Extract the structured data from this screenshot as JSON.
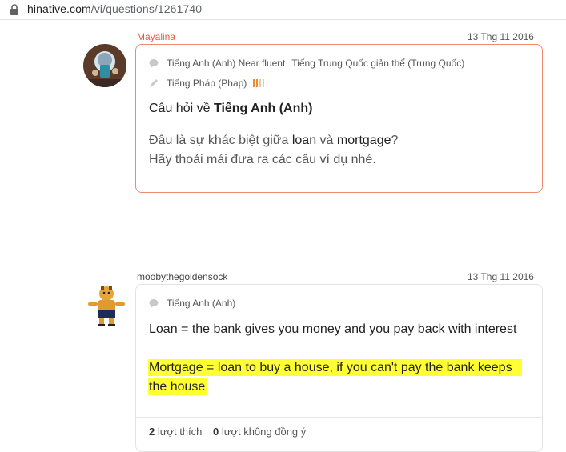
{
  "browser": {
    "url_host": "hinative.com",
    "url_path": "/vi/questions/1261740"
  },
  "question": {
    "username": "Mayalina",
    "username_color": "#f0593e",
    "date": "13 Thg 11 2016",
    "languages": [
      "Tiếng Anh (Anh) Near fluent",
      "Tiếng Trung Quốc giản thể (Trung Quốc)"
    ],
    "studying": "Tiếng Pháp (Phap)",
    "level_colors": [
      "#f08a2c",
      "#f08a2c",
      "#f4c6a0",
      "#f4c6a0"
    ],
    "title_prefix": "Câu hỏi về",
    "title_lang": "Tiếng Anh (Anh)",
    "line1_a": "Đâu là sự khác biệt giữa ",
    "word1": "loan",
    "line1_b": " và ",
    "word2": "mortgage",
    "line1_c": "?",
    "line2": "Hãy thoải mái đưa ra các câu ví dụ nhé.",
    "border_color": "#f08a6c"
  },
  "answer": {
    "username": "moobythegoldensock",
    "date": "13 Thg 11 2016",
    "language": "Tiếng Anh (Anh)",
    "line1": "Loan = the bank gives you money and you pay back with interest",
    "highlight_line1": "Mortgage = loan to buy a house, if you can't pay the bank keeps",
    "highlight_line2": "the house",
    "highlight_color": "#ffff33",
    "likes_count": "2",
    "likes_label": "lượt thích",
    "disagree_count": "0",
    "disagree_label": "lượt không đồng ý"
  }
}
